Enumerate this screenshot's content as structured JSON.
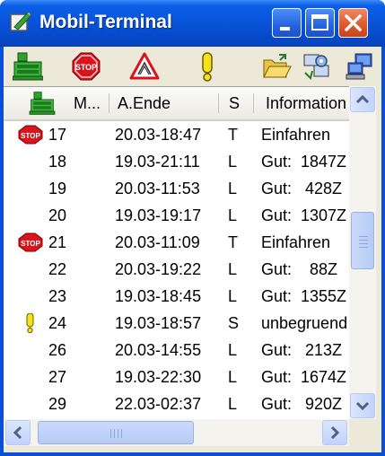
{
  "window": {
    "title": "Mobil-Terminal",
    "accent_color": "#0a4fd6",
    "close_color": "#e05a2c"
  },
  "toolbar": {
    "buttons": [
      {
        "icon": "green-terminal-icon"
      },
      {
        "icon": "stop-sign-icon",
        "label": "STOP"
      },
      {
        "icon": "warning-triangle-icon"
      },
      {
        "icon": "exclamation-icon"
      },
      {
        "icon": "open-folder-icon"
      },
      {
        "icon": "settings-transfer-icon"
      },
      {
        "icon": "network-computer-icon"
      }
    ]
  },
  "list": {
    "columns": {
      "icon": "green-terminal-icon",
      "number": "M...",
      "end": "A.Ende",
      "status": "S",
      "info": "Information"
    },
    "rows": [
      {
        "icon": "stop",
        "number": "17",
        "end": "20.03-18:47",
        "status": "T",
        "info": "Einfahren"
      },
      {
        "icon": "",
        "number": "18",
        "end": "19.03-21:11",
        "status": "L",
        "info": "Gut:  1847Z"
      },
      {
        "icon": "",
        "number": "19",
        "end": "20.03-11:53",
        "status": "L",
        "info": "Gut:   428Z"
      },
      {
        "icon": "",
        "number": "20",
        "end": "19.03-19:17",
        "status": "L",
        "info": "Gut:  1307Z"
      },
      {
        "icon": "stop",
        "number": "21",
        "end": "20.03-11:09",
        "status": "T",
        "info": "Einfahren"
      },
      {
        "icon": "",
        "number": "22",
        "end": "20.03-19:22",
        "status": "L",
        "info": "Gut:    88Z"
      },
      {
        "icon": "",
        "number": "23",
        "end": "19.03-18:45",
        "status": "L",
        "info": "Gut:  1355Z"
      },
      {
        "icon": "exclamation",
        "number": "24",
        "end": "19.03-18:57",
        "status": "S",
        "info": "unbegruend"
      },
      {
        "icon": "",
        "number": "26",
        "end": "20.03-14:55",
        "status": "L",
        "info": "Gut:   213Z"
      },
      {
        "icon": "",
        "number": "27",
        "end": "19.03-22:30",
        "status": "L",
        "info": "Gut:  1674Z"
      },
      {
        "icon": "",
        "number": "29",
        "end": "22.03-02:37",
        "status": "L",
        "info": "Gut:   920Z"
      }
    ],
    "stop_label": "STOP"
  }
}
